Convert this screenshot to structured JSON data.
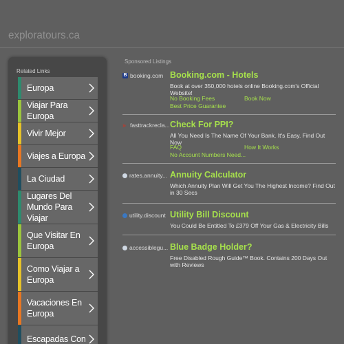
{
  "header": {
    "site_title": "exploratours.ca"
  },
  "sidebar": {
    "heading": "Related Links",
    "items": [
      {
        "label": "Europa",
        "color": "#2e8b6e"
      },
      {
        "label": "Viajar Para Europa",
        "color": "#9bc53d"
      },
      {
        "label": "Vivir Mejor",
        "color": "#e6c229"
      },
      {
        "label": "Viajes a Europa",
        "color": "#e87722"
      },
      {
        "label": "La Ciudad",
        "color": "#1f4e5f"
      },
      {
        "label": "Lugares Del Mundo Para Viajar",
        "color": "#2e8b6e"
      },
      {
        "label": "Que Visitar En Europa",
        "color": "#9bc53d"
      },
      {
        "label": "Como Viajar a Europa",
        "color": "#e6c229"
      },
      {
        "label": "Vacaciones En Europa",
        "color": "#e87722"
      },
      {
        "label": "Escapadas Con",
        "color": "#1f4e5f"
      }
    ]
  },
  "sponsored_heading": "Sponsored Listings",
  "listings": [
    {
      "source": "booking.com",
      "icon": "booking-icon",
      "icon_color": "#1e3b8a",
      "title": "Booking.com - Hotels",
      "desc": "Book at over 350,000 hotels online Booking.com's Official Website!",
      "links": [
        "No Booking Fees",
        "Book Now",
        "Best Price Guarantee"
      ]
    },
    {
      "source": "fasttrackrecla...",
      "icon": "fasttrack-icon",
      "icon_color": "#c0392b",
      "title": "Check For PPI?",
      "desc": "All You Need Is The Name Of Your Bank. It's Easy. Find Out Now",
      "links": [
        "FAQ",
        "How It Works",
        "No Account Numbers Need..."
      ]
    },
    {
      "source": "rates.annuity...",
      "icon": "globe-icon",
      "icon_color": "#cfd8e3",
      "title": "Annuity Calculator",
      "desc": "Which Annuity Plan Will Get You The Highest Income? Find Out in 30 Secs",
      "links": []
    },
    {
      "source": "utility.discount",
      "icon": "utility-icon",
      "icon_color": "#3a78c2",
      "title": "Utility Bill Discount",
      "desc": "You Could Be Entitled To £379 Off Your Gas & Electricity Bills",
      "links": []
    },
    {
      "source": "accessiblegu...",
      "icon": "globe-icon",
      "icon_color": "#cfd8e3",
      "title": "Blue Badge Holder?",
      "desc": "Free Disabled Rough Guide™ Book. Contains 200 Days Out with Reviews",
      "links": []
    }
  ]
}
